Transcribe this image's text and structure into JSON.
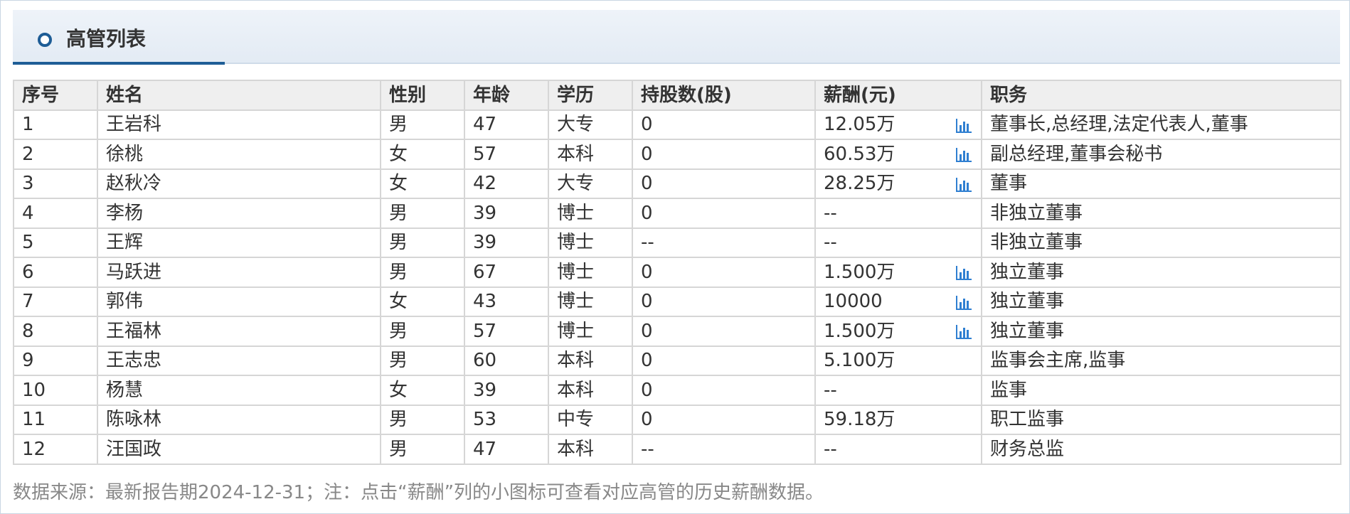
{
  "panel": {
    "title": "高管列表"
  },
  "table": {
    "headers": [
      "序号",
      "姓名",
      "性别",
      "年龄",
      "学历",
      "持股数(股)",
      "薪酬(元)",
      "职务"
    ],
    "rows": [
      {
        "no": "1",
        "name": "王岩科",
        "gender": "男",
        "age": "47",
        "edu": "大专",
        "shares": "0",
        "salary": "12.05万",
        "has_chart": true,
        "title": "董事长,总经理,法定代表人,董事"
      },
      {
        "no": "2",
        "name": "徐桃",
        "gender": "女",
        "age": "57",
        "edu": "本科",
        "shares": "0",
        "salary": "60.53万",
        "has_chart": true,
        "title": "副总经理,董事会秘书"
      },
      {
        "no": "3",
        "name": "赵秋冷",
        "gender": "女",
        "age": "42",
        "edu": "大专",
        "shares": "0",
        "salary": "28.25万",
        "has_chart": true,
        "title": "董事"
      },
      {
        "no": "4",
        "name": "李杨",
        "gender": "男",
        "age": "39",
        "edu": "博士",
        "shares": "0",
        "salary": "--",
        "has_chart": false,
        "title": "非独立董事"
      },
      {
        "no": "5",
        "name": "王辉",
        "gender": "男",
        "age": "39",
        "edu": "博士",
        "shares": "--",
        "salary": "--",
        "has_chart": false,
        "title": "非独立董事"
      },
      {
        "no": "6",
        "name": "马跃进",
        "gender": "男",
        "age": "67",
        "edu": "博士",
        "shares": "0",
        "salary": "1.500万",
        "has_chart": true,
        "title": "独立董事"
      },
      {
        "no": "7",
        "name": "郭伟",
        "gender": "女",
        "age": "43",
        "edu": "博士",
        "shares": "0",
        "salary": "10000",
        "has_chart": true,
        "title": "独立董事"
      },
      {
        "no": "8",
        "name": "王福林",
        "gender": "男",
        "age": "57",
        "edu": "博士",
        "shares": "0",
        "salary": "1.500万",
        "has_chart": true,
        "title": "独立董事"
      },
      {
        "no": "9",
        "name": "王志忠",
        "gender": "男",
        "age": "60",
        "edu": "本科",
        "shares": "0",
        "salary": "5.100万",
        "has_chart": false,
        "title": "监事会主席,监事"
      },
      {
        "no": "10",
        "name": "杨慧",
        "gender": "女",
        "age": "39",
        "edu": "本科",
        "shares": "0",
        "salary": "--",
        "has_chart": false,
        "title": "监事"
      },
      {
        "no": "11",
        "name": "陈咏林",
        "gender": "男",
        "age": "53",
        "edu": "中专",
        "shares": "0",
        "salary": "59.18万",
        "has_chart": false,
        "title": "职工监事"
      },
      {
        "no": "12",
        "name": "汪国政",
        "gender": "男",
        "age": "47",
        "edu": "本科",
        "shares": "--",
        "salary": "--",
        "has_chart": false,
        "title": "财务总监"
      }
    ]
  },
  "footnote": "数据来源：最新报告期2024-12-31；注：点击“薪酬”列的小图标可查看对应高管的历史薪酬数据。",
  "colors": {
    "accent": "#1e5d96",
    "chart_icon": "#2f7fd1",
    "header_bg": "#efefef",
    "border": "#d6d6d6"
  },
  "icons": {
    "header": "circle-ring-icon",
    "salary_history": "bar-chart-icon"
  }
}
